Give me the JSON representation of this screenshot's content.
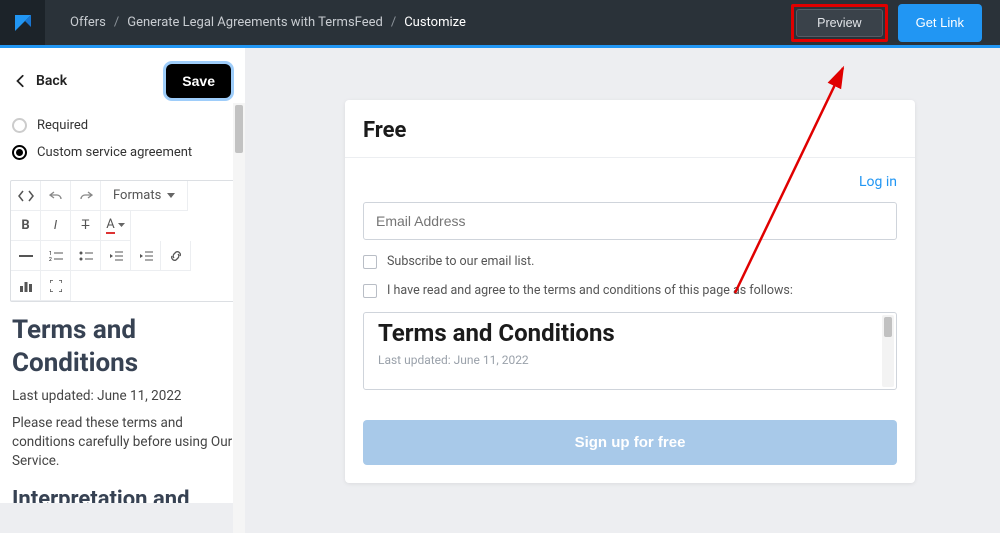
{
  "breadcrumb": {
    "a": "Offers",
    "b": "Generate Legal Agreements with TermsFeed",
    "c": "Customize"
  },
  "top": {
    "preview": "Preview",
    "getlink": "Get Link"
  },
  "sidebar": {
    "back": "Back",
    "save": "Save",
    "radios": {
      "required": "Required",
      "custom": "Custom service agreement"
    },
    "toolbar": {
      "formats": "Formats"
    },
    "doc": {
      "h1": "Terms and Conditions",
      "updated": "Last updated: June 11, 2022",
      "p1": "Please read these terms and conditions carefully before using Our Service.",
      "h2": "Interpretation and Definitions"
    }
  },
  "card": {
    "title": "Free",
    "login": "Log in",
    "email_ph": "Email Address",
    "subscribe": "Subscribe to our email list.",
    "agree": "I have read and agree to the terms and conditions of this page as follows:",
    "terms_h": "Terms and Conditions",
    "terms_sub": "Last updated: June 11, 2022",
    "signup": "Sign up for free"
  }
}
